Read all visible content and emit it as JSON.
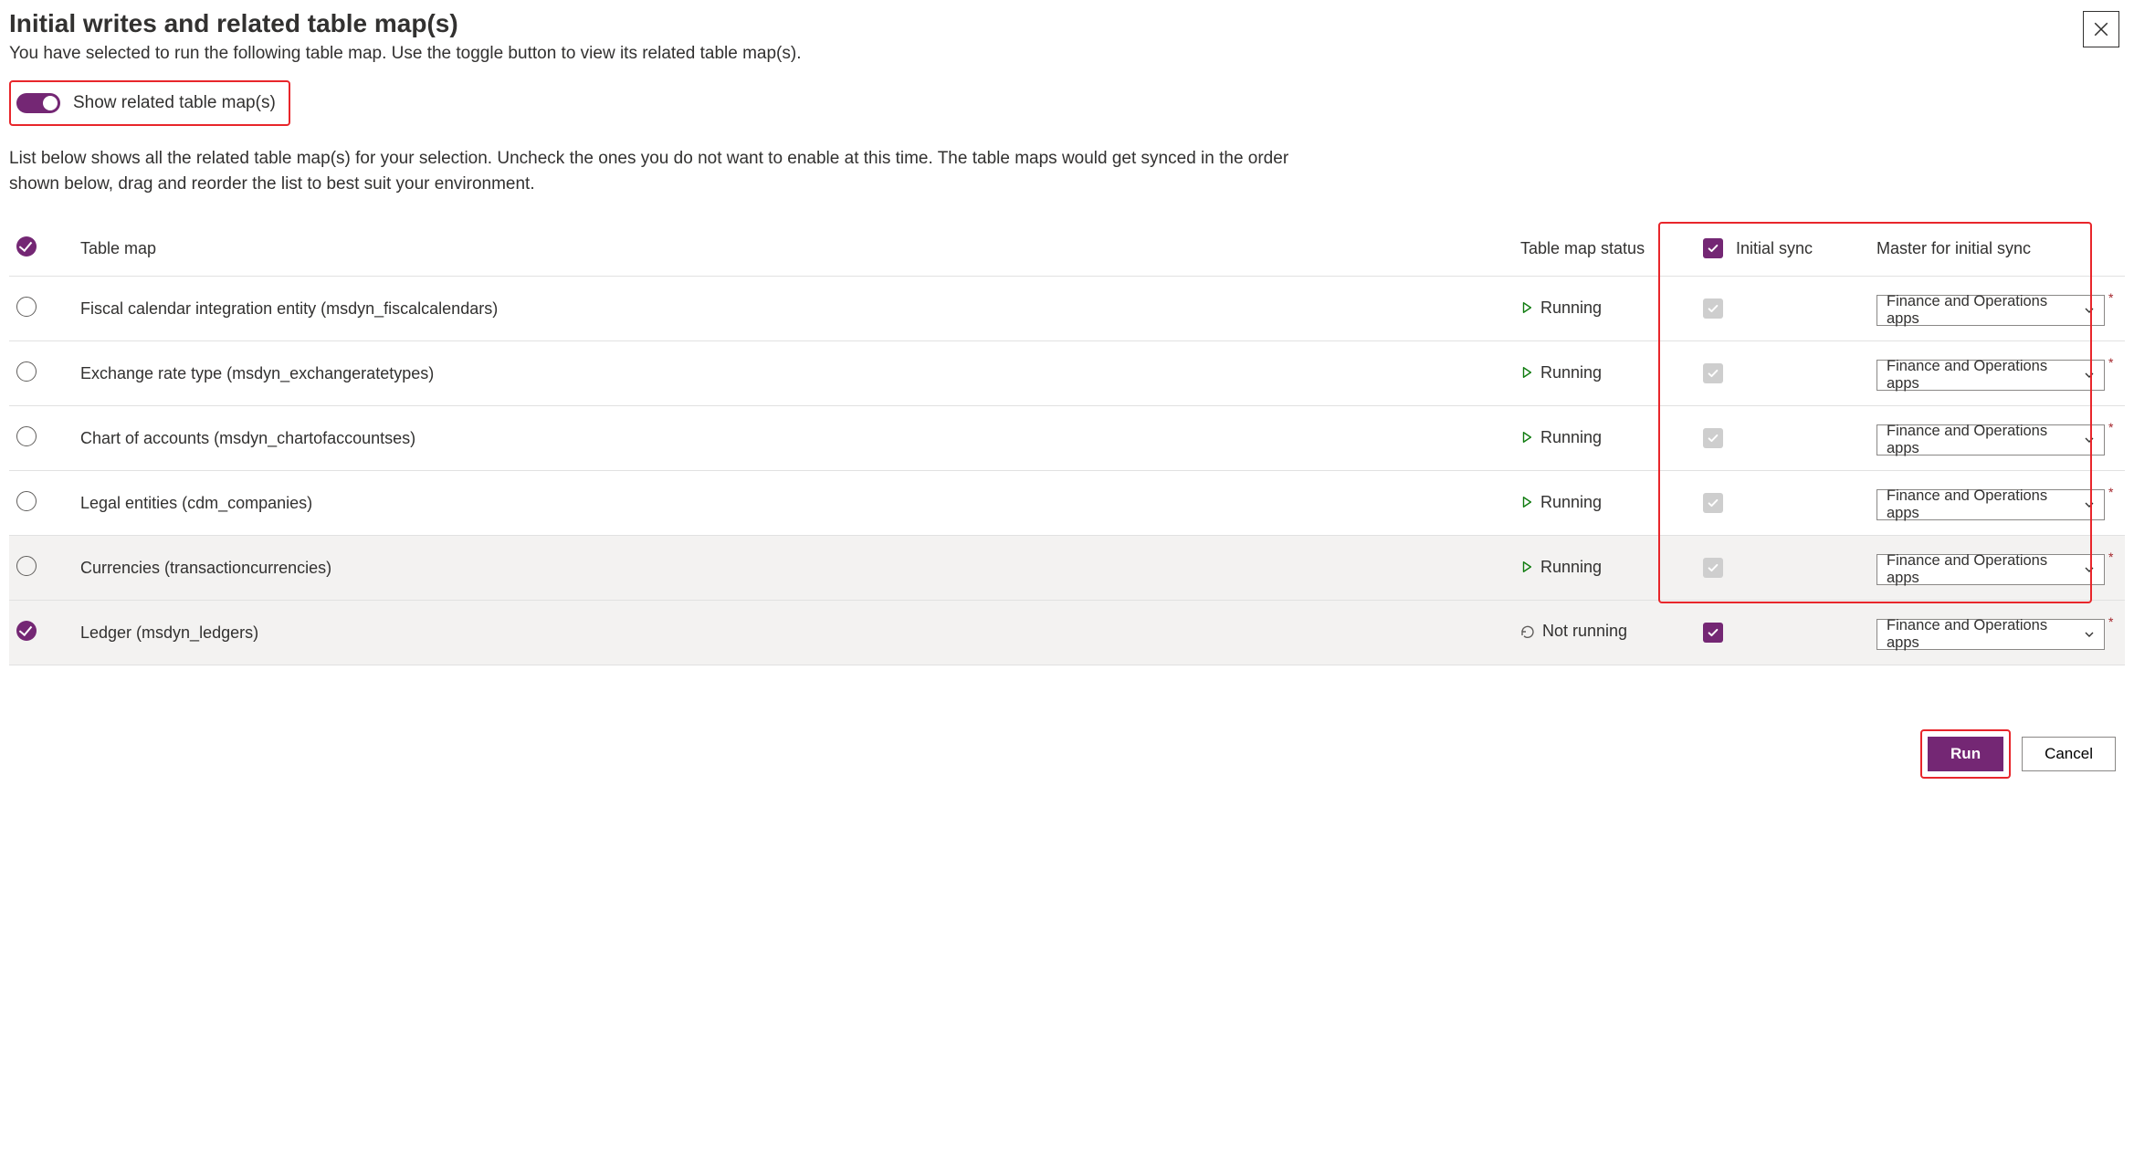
{
  "header": {
    "title": "Initial writes and related table map(s)",
    "subtitle": "You have selected to run the following table map. Use the toggle button to view its related table map(s).",
    "toggle_label": "Show related table map(s)",
    "description": "List below shows all the related table map(s) for your selection. Uncheck the ones you do not want to enable at this time. The table maps would get synced in the order shown below, drag and reorder the list to best suit your environment."
  },
  "columns": {
    "table_map": "Table map",
    "status": "Table map status",
    "initial_sync": "Initial sync",
    "master": "Master for initial sync"
  },
  "status_labels": {
    "running": "Running",
    "not_running": "Not running"
  },
  "master_default": "Finance and Operations apps",
  "rows": [
    {
      "selected": false,
      "name": "Fiscal calendar integration entity (msdyn_fiscalcalendars)",
      "status": "running",
      "init_checked": true,
      "init_enabled": false,
      "master": "Finance and Operations apps",
      "shaded": false
    },
    {
      "selected": false,
      "name": "Exchange rate type (msdyn_exchangeratetypes)",
      "status": "running",
      "init_checked": true,
      "init_enabled": false,
      "master": "Finance and Operations apps",
      "shaded": false
    },
    {
      "selected": false,
      "name": "Chart of accounts (msdyn_chartofaccountses)",
      "status": "running",
      "init_checked": true,
      "init_enabled": false,
      "master": "Finance and Operations apps",
      "shaded": false
    },
    {
      "selected": false,
      "name": "Legal entities (cdm_companies)",
      "status": "running",
      "init_checked": true,
      "init_enabled": false,
      "master": "Finance and Operations apps",
      "shaded": false
    },
    {
      "selected": false,
      "name": "Currencies (transactioncurrencies)",
      "status": "running",
      "init_checked": true,
      "init_enabled": false,
      "master": "Finance and Operations apps",
      "shaded": true
    },
    {
      "selected": true,
      "name": "Ledger (msdyn_ledgers)",
      "status": "not_running",
      "init_checked": true,
      "init_enabled": true,
      "master": "Finance and Operations apps",
      "shaded": true
    }
  ],
  "footer": {
    "run": "Run",
    "cancel": "Cancel"
  },
  "colors": {
    "accent": "#742774",
    "annotation": "#e8262b",
    "run_green": "#107C10"
  }
}
